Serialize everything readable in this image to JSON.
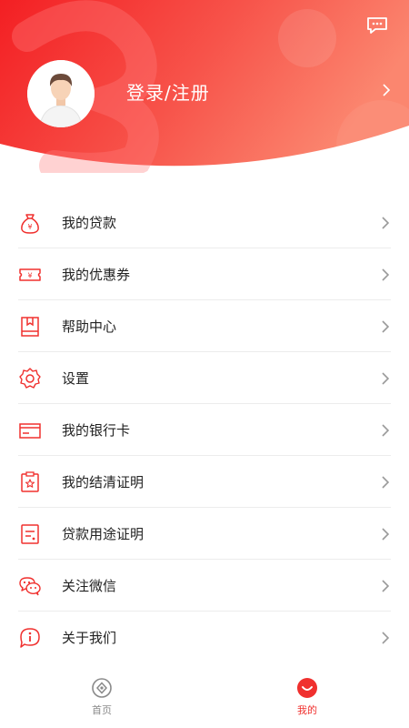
{
  "header": {
    "login_label": "登录/注册"
  },
  "menu": [
    {
      "label": "我的贷款",
      "icon": "money-bag-icon"
    },
    {
      "label": "我的优惠券",
      "icon": "coupon-icon"
    },
    {
      "label": "帮助中心",
      "icon": "help-book-icon"
    },
    {
      "label": "设置",
      "icon": "gear-icon"
    },
    {
      "label": "我的银行卡",
      "icon": "bank-card-icon"
    },
    {
      "label": "我的结清证明",
      "icon": "settlement-certificate-icon"
    },
    {
      "label": "贷款用途证明",
      "icon": "loan-purpose-document-icon"
    },
    {
      "label": "关注微信",
      "icon": "wechat-icon"
    },
    {
      "label": "关于我们",
      "icon": "info-icon"
    }
  ],
  "tabbar": {
    "home_label": "首页",
    "mine_label": "我的",
    "active": "mine"
  },
  "colors": {
    "brand_red": "#f0302e",
    "header_gradient_start": "#f31f23",
    "header_gradient_end": "#fb7f6a",
    "inactive_tab": "#8a8a8a"
  }
}
